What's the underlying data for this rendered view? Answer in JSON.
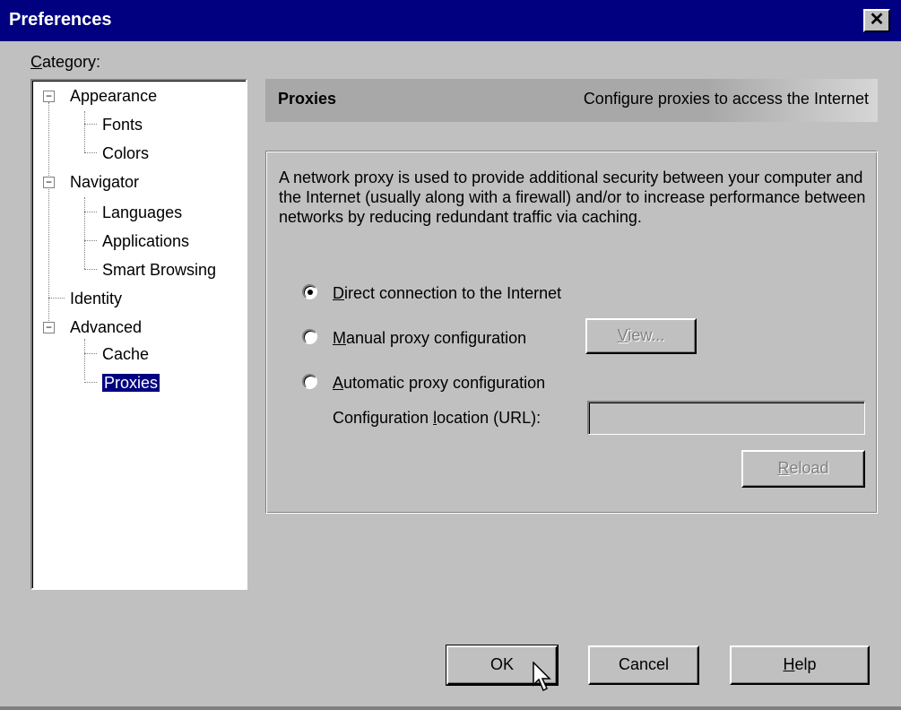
{
  "window": {
    "title": "Preferences",
    "close_glyph": "✕"
  },
  "category": {
    "label": "Category:",
    "tree": [
      {
        "label": "Appearance",
        "expander": "−"
      },
      {
        "label": "Fonts"
      },
      {
        "label": "Colors"
      },
      {
        "label": "Navigator",
        "expander": "−"
      },
      {
        "label": "Languages"
      },
      {
        "label": "Applications"
      },
      {
        "label": "Smart Browsing"
      },
      {
        "label": "Identity"
      },
      {
        "label": "Advanced",
        "expander": "−"
      },
      {
        "label": "Cache"
      },
      {
        "label": "Proxies",
        "selected": true
      }
    ]
  },
  "panel": {
    "title": "Proxies",
    "description": "Configure proxies to access the Internet",
    "body_text": "A network proxy is used to provide additional security between your computer and the Internet (usually along with a firewall) and/or to increase performance between networks by reducing redundant traffic via caching.",
    "options": [
      {
        "label": "Direct connection to the Internet",
        "checked": true
      },
      {
        "label": "Manual proxy configuration",
        "checked": false
      },
      {
        "label": "Automatic proxy configuration",
        "checked": false
      }
    ],
    "view_button": "View...",
    "url_label": "Configuration location (URL):",
    "url_value": "",
    "reload_button": "Reload"
  },
  "buttons": {
    "ok": "OK",
    "cancel": "Cancel",
    "help": "Help"
  },
  "colors": {
    "titlebar": "#000080",
    "face": "#c0c0c0",
    "selection": "#000080"
  }
}
